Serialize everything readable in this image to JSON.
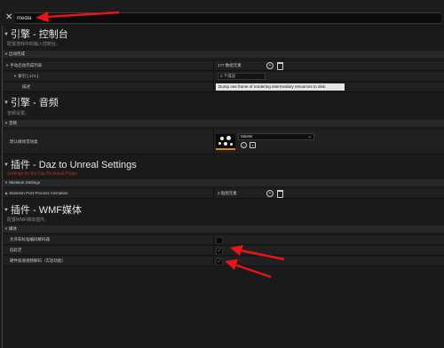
{
  "search": {
    "value": "media"
  },
  "sections": {
    "engine_console": {
      "title": "引擎 - 控制台",
      "subtitle": "配置游戏中的输入控制台。",
      "category": "启动完成",
      "rows": {
        "startup_commands_label": "手动启动完成列表",
        "startup_commands_value": "177 数组元素",
        "index_label": "索引 [ 171 ]",
        "index_value": "2 个成员",
        "desc_label": "描述",
        "tooltip": "Dump one frame of rendering intermediary resources to disk."
      }
    },
    "engine_audio": {
      "title": "引擎 - 音频",
      "subtitle": "音频设置。",
      "category": "音频",
      "default_media_label": "默认媒体音效类",
      "master_value": "Master"
    },
    "daz": {
      "title": "插件 - Daz to Unreal Settings",
      "subtitle": "Settings for the DazToUnreal Plugin",
      "category": "Skeleton Settings",
      "row_label": "Skeleton Post Process Animation",
      "row_value": "2 贴图元素"
    },
    "wmf": {
      "title": "插件 - WMF媒体",
      "subtitle": "配置WMF媒体插件。",
      "category": "媒体",
      "rows": [
        {
          "label": "允许非标准编码解码器",
          "checked": false
        },
        {
          "label": "低延迟",
          "checked": true
        },
        {
          "label": "硬件加速视频解码（实验功能）",
          "checked": true
        }
      ]
    }
  },
  "icons": {
    "close": "close-icon",
    "add": "add-icon",
    "delete": "trash-icon",
    "browse": "arrow-icon",
    "find": "search-icon"
  },
  "colors": {
    "annotation_arrow": "#e8141a",
    "checkbox_check": "#3a8fd8",
    "thumb_bar": "#e0860f"
  },
  "glyphs": {
    "close": "✕",
    "add": "+",
    "check": "✓",
    "chev": "⌄",
    "tri_down": "▼",
    "tri_right": "▶"
  }
}
